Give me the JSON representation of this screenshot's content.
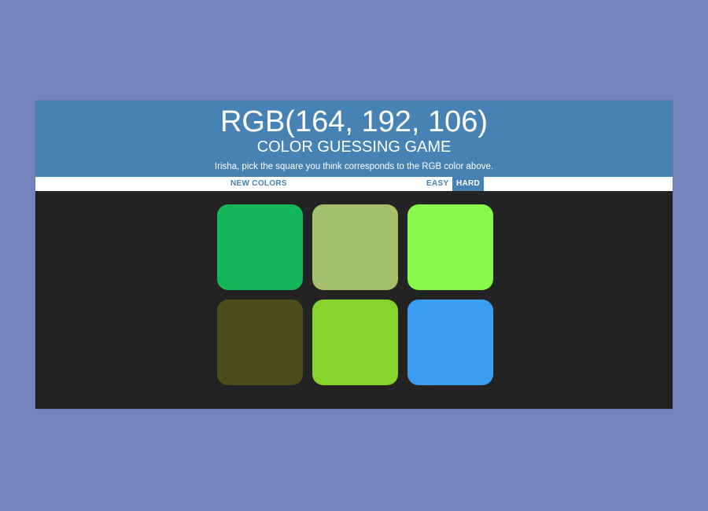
{
  "header": {
    "rgb_text": "RGB(164, 192, 106)",
    "title": "COLOR GUESSING GAME",
    "instructions": "Irisha, pick the square you think corresponds to the RGB color above."
  },
  "controls": {
    "new_colors": "NEW COLORS",
    "easy": "EASY",
    "hard": "HARD",
    "selected_mode": "hard"
  },
  "squares": [
    {
      "color": "#14b85a"
    },
    {
      "color": "#a4c06a"
    },
    {
      "color": "#88f84a"
    },
    {
      "color": "#4e4c18"
    },
    {
      "color": "#86d42c"
    },
    {
      "color": "#3b9ef0"
    }
  ],
  "colors": {
    "page_background": "#7584bd",
    "header_background": "#4682b4",
    "board_background": "#232323",
    "stripe_background": "#ffffff"
  }
}
